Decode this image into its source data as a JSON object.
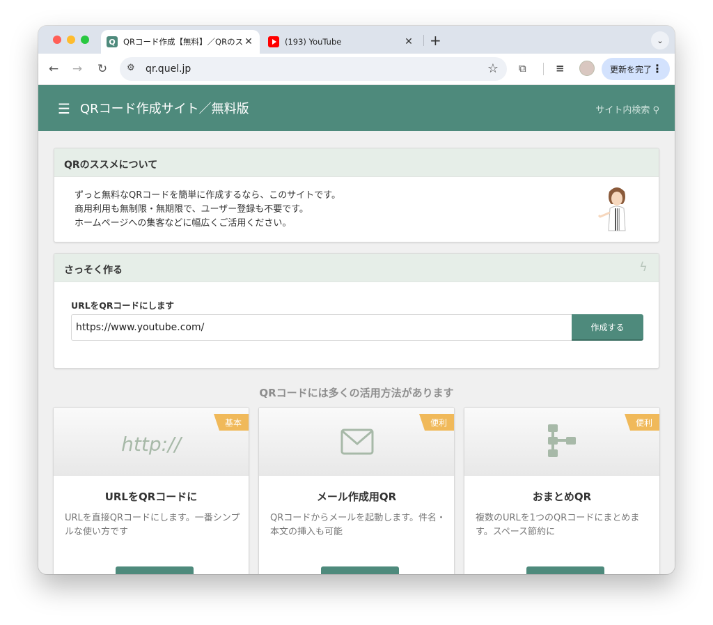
{
  "browser": {
    "tabs": [
      {
        "title": "QRコード作成【無料】／QRのス",
        "favicon": "Q",
        "active": true
      },
      {
        "title": "(193) YouTube",
        "favicon": "youtube-icon",
        "active": false
      }
    ],
    "url": "qr.quel.jp",
    "update_button": "更新を完了"
  },
  "site": {
    "title": "QRコード作成サイト／無料版",
    "search_label": "サイト内検索",
    "accent_color": "#4e8a7c"
  },
  "about": {
    "heading": "QRのススメについて",
    "lines": [
      "ずっと無料なQRコードを簡単に作成するなら、このサイトです。",
      "商用利用も無制限・無期限で、ユーザー登録も不要です。",
      "ホームページへの集客などに幅広くご活用ください。"
    ]
  },
  "make": {
    "heading": "さっそく作る",
    "field_label": "URLをQRコードにします",
    "url_value": "https://www.youtube.com/",
    "button": "作成する"
  },
  "uses": {
    "heading": "QRコードには多くの活用方法があります",
    "cards": [
      {
        "badge": "基本",
        "icon_text": "http://",
        "title": "URLをQRコードに",
        "desc": "URLを直接QRコードにします。一番シンプルな使い方です"
      },
      {
        "badge": "便利",
        "icon": "mail-icon",
        "title": "メール作成用QR",
        "desc": "QRコードからメールを起動します。件名・本文の挿入も可能"
      },
      {
        "badge": "便利",
        "icon": "tree-icon",
        "title": "おまとめQR",
        "desc": "複数のURLを1つのQRコードにまとめます。スペース節約に"
      }
    ]
  }
}
